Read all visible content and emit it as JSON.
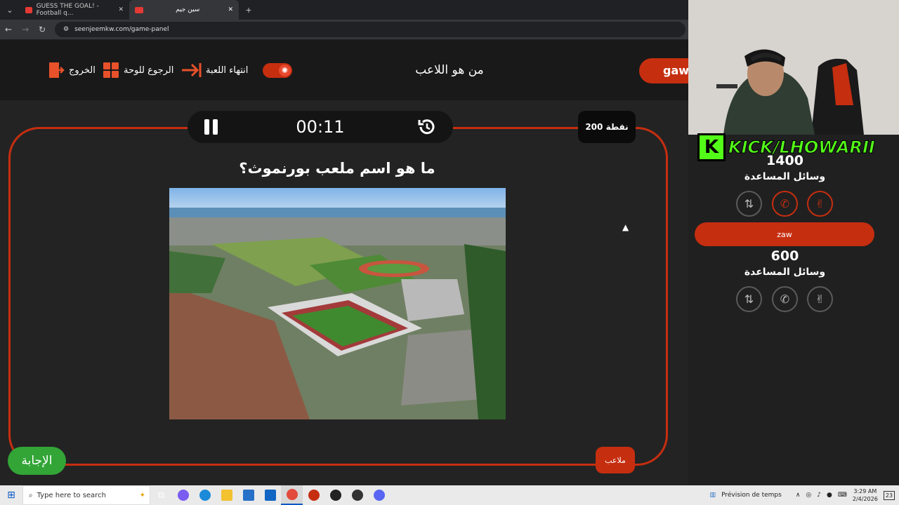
{
  "browser": {
    "tabs": [
      {
        "title": "GUESS THE GOAL! - Football q...",
        "favicon_color": "#e53935"
      },
      {
        "title": "سين جيم",
        "favicon_color": "#e53935"
      }
    ],
    "url": "seenjeemkw.com/game-panel"
  },
  "header": {
    "exit_label": "الخروج",
    "back_to_board_label": "الرجوع للوحة",
    "end_game_label": "انتهاء اللعبة",
    "page_title": "من هو اللاعب",
    "team_badge": "gaw"
  },
  "timer": {
    "time": "00:11"
  },
  "points_badge": "200 نقطة",
  "question": "ما هو اسم ملعب بورنموث؟",
  "answer_button": "الإجابة",
  "category_badge": "ملاعب",
  "sidebar": {
    "streamer_tag": "KICK/LHOWARII",
    "teams": [
      {
        "score": "1400",
        "aids_label": "وسائل المساعدة"
      },
      {
        "name": "zaw",
        "score": "600",
        "aids_label": "وسائل المساعدة"
      }
    ]
  },
  "taskbar": {
    "search_placeholder": "Type here to search",
    "weather": "Prévision de temps",
    "time": "3:29 AM",
    "date": "2/4/2026",
    "notifications": "23"
  },
  "colors": {
    "accent": "#c62e10",
    "answer": "#32a536",
    "kick": "#53fc18"
  }
}
